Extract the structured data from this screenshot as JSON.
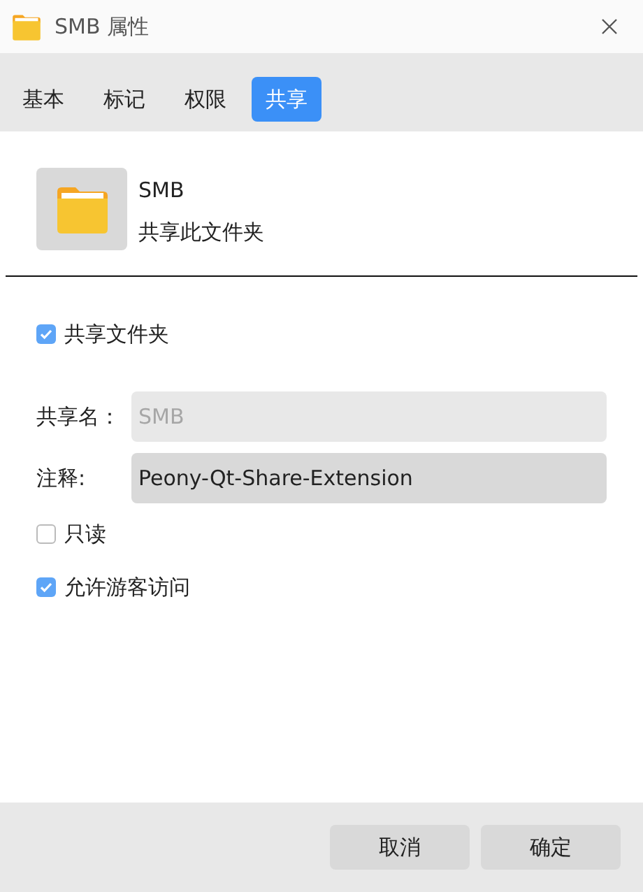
{
  "window": {
    "title": "SMB 属性"
  },
  "tabs": [
    {
      "label": "基本",
      "selected": false
    },
    {
      "label": "标记",
      "selected": false
    },
    {
      "label": "权限",
      "selected": false
    },
    {
      "label": "共享",
      "selected": true
    }
  ],
  "header": {
    "name": "SMB",
    "subtitle": "共享此文件夹"
  },
  "share_toggle": {
    "label": "共享文件夹",
    "checked": true
  },
  "fields": [
    {
      "label": "共享名：",
      "value": "SMB",
      "disabled": true
    },
    {
      "label": "注释:",
      "value": "Peony-Qt-Share-Extension",
      "disabled": false
    }
  ],
  "options": [
    {
      "label": "只读",
      "checked": false
    },
    {
      "label": "允许游客访问",
      "checked": true
    }
  ],
  "buttons": [
    "取消",
    "确定"
  ]
}
